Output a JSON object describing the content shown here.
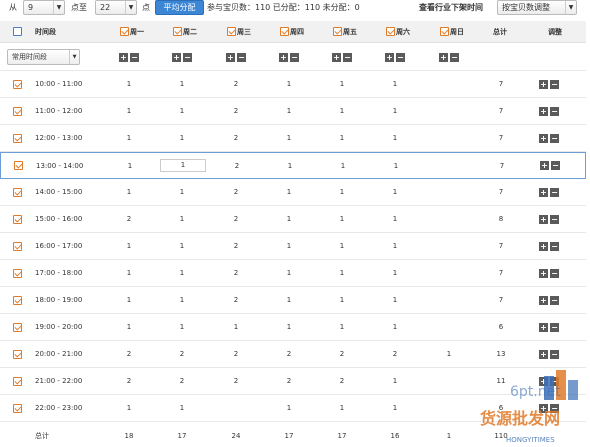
{
  "toolbar": {
    "from_label": "从",
    "from_value": "9",
    "to_label": "点至",
    "to_value": "22",
    "hour_label": "点",
    "distribute_button": "平均分配",
    "stats_text": "参与宝贝数：110  已分配：110  未分配：0",
    "industry_title": "查看行业下架时间",
    "adjust_select": "按宝贝数调整"
  },
  "header": {
    "time_col": "时间段",
    "days": [
      "周一",
      "周二",
      "周三",
      "周四",
      "周五",
      "周六",
      "周日"
    ],
    "total_col": "总计",
    "adjust_col": "调整"
  },
  "common_select": "常用时间段",
  "rows": [
    {
      "time": "10:00 - 11:00",
      "vals": [
        "1",
        "1",
        "2",
        "1",
        "1",
        "1",
        ""
      ],
      "total": "7"
    },
    {
      "time": "11:00 - 12:00",
      "vals": [
        "1",
        "1",
        "2",
        "1",
        "1",
        "1",
        ""
      ],
      "total": "7"
    },
    {
      "time": "12:00 - 13:00",
      "vals": [
        "1",
        "1",
        "2",
        "1",
        "1",
        "1",
        ""
      ],
      "total": "7"
    },
    {
      "time": "13:00 - 14:00",
      "vals": [
        "1",
        "1",
        "2",
        "1",
        "1",
        "1",
        ""
      ],
      "total": "7"
    },
    {
      "time": "14:00 - 15:00",
      "vals": [
        "1",
        "1",
        "2",
        "1",
        "1",
        "1",
        ""
      ],
      "total": "7"
    },
    {
      "time": "15:00 - 16:00",
      "vals": [
        "2",
        "1",
        "2",
        "1",
        "1",
        "1",
        ""
      ],
      "total": "8"
    },
    {
      "time": "16:00 - 17:00",
      "vals": [
        "1",
        "1",
        "2",
        "1",
        "1",
        "1",
        ""
      ],
      "total": "7"
    },
    {
      "time": "17:00 - 18:00",
      "vals": [
        "1",
        "1",
        "2",
        "1",
        "1",
        "1",
        ""
      ],
      "total": "7"
    },
    {
      "time": "18:00 - 19:00",
      "vals": [
        "1",
        "1",
        "2",
        "1",
        "1",
        "1",
        ""
      ],
      "total": "7"
    },
    {
      "time": "19:00 - 20:00",
      "vals": [
        "1",
        "1",
        "1",
        "1",
        "1",
        "1",
        ""
      ],
      "total": "6"
    },
    {
      "time": "20:00 - 21:00",
      "vals": [
        "2",
        "2",
        "2",
        "2",
        "2",
        "2",
        "1"
      ],
      "total": "13"
    },
    {
      "time": "21:00 - 22:00",
      "vals": [
        "2",
        "2",
        "2",
        "2",
        "2",
        "1",
        ""
      ],
      "total": "11"
    },
    {
      "time": "22:00 - 23:00",
      "vals": [
        "1",
        "1",
        "",
        "1",
        "1",
        "1",
        ""
      ],
      "total": "6"
    }
  ],
  "totals": {
    "label": "总计",
    "vals": [
      "18",
      "17",
      "24",
      "17",
      "17",
      "16",
      "1"
    ],
    "total": "110"
  },
  "watermark": {
    "text": "货源批发网",
    "domain": "6pt.net",
    "sub": "HONGYITIMES"
  },
  "colors": {
    "accent": "#3b87d6",
    "checkbox": "#e07b2a",
    "highlight_border": "#6d9fd6"
  }
}
